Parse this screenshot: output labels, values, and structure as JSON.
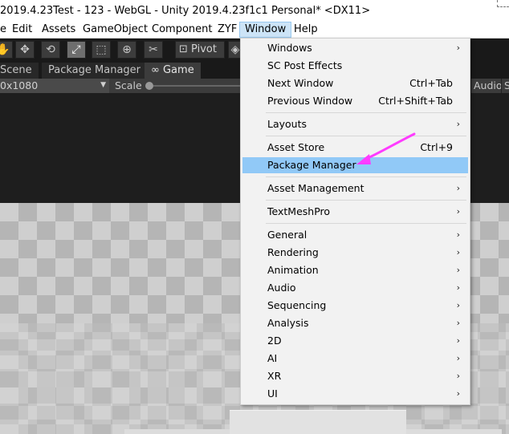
{
  "window": {
    "title": "2019.4.23Test - 123 - WebGL - Unity 2019.4.23f1c1 Personal* <DX11>"
  },
  "menubar": {
    "items": [
      "e",
      "Edit",
      "Assets",
      "GameObject",
      "Component",
      "ZYF",
      "Window",
      "Help"
    ],
    "active": "Window"
  },
  "toolbar": {
    "pivot_label": "Pivot",
    "tools": [
      "hand-tool",
      "move-tool",
      "rotate-tool",
      "scale-tool",
      "rect-tool",
      "transform-tool",
      "custom-tool"
    ]
  },
  "tabs": [
    {
      "label": "Scene"
    },
    {
      "label": "Package Manager"
    },
    {
      "label": "Game"
    }
  ],
  "game_toolbar": {
    "resolution": "0x1080",
    "scale_label": "Scale",
    "audio_label": "Audio",
    "audio2_label": "S"
  },
  "dropdown": {
    "groups": [
      [
        {
          "label": "Windows",
          "submenu": true
        },
        {
          "label": "SC Post Effects"
        },
        {
          "label": "Next Window",
          "shortcut": "Ctrl+Tab"
        },
        {
          "label": "Previous Window",
          "shortcut": "Ctrl+Shift+Tab"
        }
      ],
      [
        {
          "label": "Layouts",
          "submenu": true
        }
      ],
      [
        {
          "label": "Asset Store",
          "shortcut": "Ctrl+9"
        },
        {
          "label": "Package Manager",
          "highlighted": true
        }
      ],
      [
        {
          "label": "Asset Management",
          "submenu": true
        }
      ],
      [
        {
          "label": "TextMeshPro",
          "submenu": true
        }
      ],
      [
        {
          "label": "General",
          "submenu": true
        },
        {
          "label": "Rendering",
          "submenu": true
        },
        {
          "label": "Animation",
          "submenu": true
        },
        {
          "label": "Audio",
          "submenu": true
        },
        {
          "label": "Sequencing",
          "submenu": true
        },
        {
          "label": "Analysis",
          "submenu": true
        },
        {
          "label": "2D",
          "submenu": true
        },
        {
          "label": "AI",
          "submenu": true
        },
        {
          "label": "XR",
          "submenu": true
        },
        {
          "label": "UI",
          "submenu": true
        }
      ]
    ],
    "submenu_glyph": "›"
  },
  "colors": {
    "highlight": "#91c9f7",
    "annotation_arrow": "#ff3cff"
  }
}
